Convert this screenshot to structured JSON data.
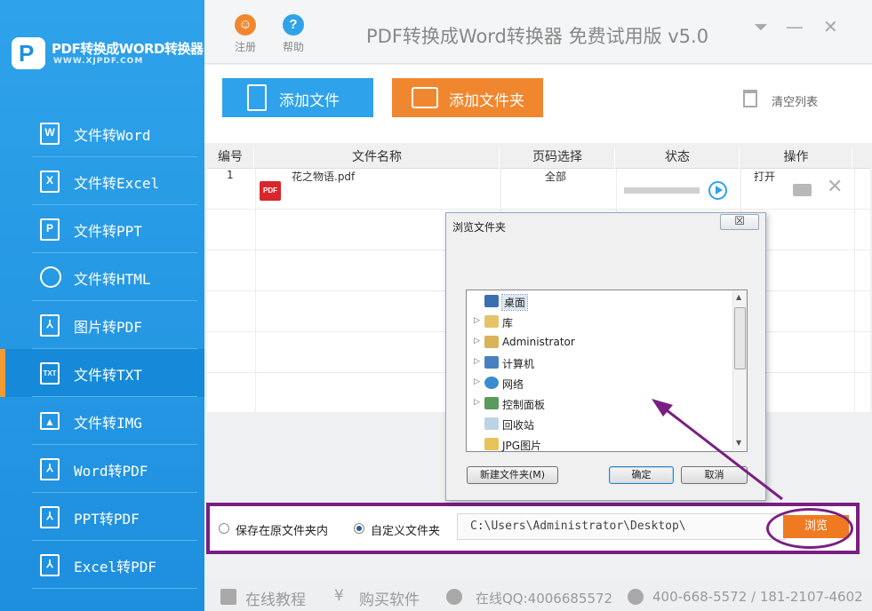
{
  "app": {
    "logo_letter": "P",
    "name": "PDF转换成WORD转换器",
    "domain": "WWW.XJPDF.COM",
    "title": "PDF转换成Word转换器 免费试用版 v5.0",
    "register_label": "注册",
    "help_label": "帮助"
  },
  "sidebar": {
    "items": [
      {
        "label": "文件转Word",
        "icon": "W"
      },
      {
        "label": "文件转Excel",
        "icon": "X"
      },
      {
        "label": "文件转PPT",
        "icon": "P"
      },
      {
        "label": "文件转HTML",
        "icon": "globe"
      },
      {
        "label": "图片转PDF",
        "icon": "pdf"
      },
      {
        "label": "文件转TXT",
        "icon": "TXT",
        "active": true
      },
      {
        "label": "文件转IMG",
        "icon": "img"
      },
      {
        "label": "Word转PDF",
        "icon": "pdf"
      },
      {
        "label": "PPT转PDF",
        "icon": "pdf"
      },
      {
        "label": "Excel转PDF",
        "icon": "pdf"
      }
    ]
  },
  "toolbar": {
    "add_file": "添加文件",
    "add_folder": "添加文件夹",
    "clear_list": "清空列表"
  },
  "table": {
    "headers": [
      "编号",
      "文件名称",
      "页码选择",
      "状态",
      "操作"
    ],
    "rows": [
      {
        "index": "1",
        "file_icon": "PDF",
        "name": "花之物语.pdf",
        "pages": "全部",
        "progress": 0,
        "action_open": "打开"
      }
    ]
  },
  "dialog": {
    "title": "浏览文件夹",
    "close": "☒",
    "tree": [
      {
        "label": "桌面",
        "expand": "",
        "selected": true
      },
      {
        "label": "库",
        "expand": "▷"
      },
      {
        "label": "Administrator",
        "expand": "▷"
      },
      {
        "label": "计算机",
        "expand": "▷"
      },
      {
        "label": "网络",
        "expand": "▷"
      },
      {
        "label": "控制面板",
        "expand": "▷"
      },
      {
        "label": "回收站",
        "expand": ""
      },
      {
        "label": "JPG图片",
        "expand": ""
      }
    ],
    "new_folder": "新建文件夹(M)",
    "ok": "确定",
    "cancel": "取消"
  },
  "save": {
    "option_original": "保存在原文件夹内",
    "option_custom": "自定义文件夹",
    "selected": "custom",
    "path": "C:\\Users\\Administrator\\Desktop\\",
    "browse": "浏览"
  },
  "footer": {
    "tutorial": "在线教程",
    "buy": "购买软件",
    "qq": "在线QQ:4006685572",
    "phone": "400-668-5572 / 181-2107-4602"
  },
  "colors": {
    "sidebar_blue": "#2ea2ea",
    "accent_orange": "#f0872f",
    "annotation_purple": "#7a1f82"
  }
}
